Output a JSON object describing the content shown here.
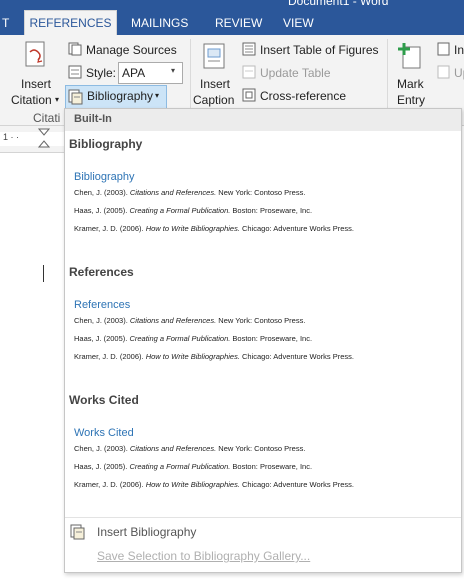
{
  "window": {
    "title": "Document1 - Word"
  },
  "tabs": {
    "left_partial": "T",
    "active": "REFERENCES",
    "mailings": "MAILINGS",
    "review": "REVIEW",
    "view": "VIEW"
  },
  "ribbon": {
    "citations_group": {
      "insert_citation_line1": "Insert",
      "insert_citation_line2": "Citation",
      "manage_sources": "Manage Sources",
      "style_label": "Style:",
      "style_value": "APA",
      "bibliography": "Bibliography",
      "group_label": "Citati"
    },
    "captions_group": {
      "insert_caption_line1": "Insert",
      "insert_caption_line2": "Caption",
      "insert_table_of_figures": "Insert Table of Figures",
      "update_table": "Update Table",
      "cross_reference": "Cross-reference"
    },
    "index_group": {
      "mark_entry_line1": "Mark",
      "mark_entry_line2": "Entry",
      "partial_insert": "In",
      "partial_update": "Up"
    }
  },
  "dropdown": {
    "section_label": "Built-In",
    "galleries": [
      {
        "title": "Bibliography",
        "heading": "Bibliography"
      },
      {
        "title": "References",
        "heading": "References"
      },
      {
        "title": "Works Cited",
        "heading": "Works Cited"
      }
    ],
    "entries": [
      {
        "author": "Chen, J. (2003). ",
        "work": "Citations and References.",
        "publisher": " New York: Contoso Press."
      },
      {
        "author": "Haas, J. (2005). ",
        "work": "Creating a Formal Publication.",
        "publisher": " Boston: Proseware, Inc."
      },
      {
        "author": "Kramer, J. D. (2006). ",
        "work": "How to Write Bibliographies.",
        "publisher": " Chicago: Adventure Works Press."
      }
    ],
    "insert_bibliography": "Insert Bibliography",
    "save_selection": "Save Selection to Bibliography Gallery..."
  },
  "colors": {
    "ribbon_blue": "#2b579a",
    "heading_blue": "#2e74b5",
    "highlight": "#cce4f7"
  }
}
